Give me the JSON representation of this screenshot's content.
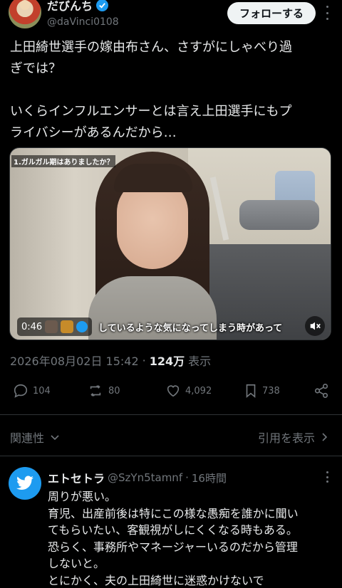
{
  "tweet": {
    "author_name": "だびんち",
    "author_handle": "@daVinci0108",
    "follow_label": "フォローする",
    "text_paragraphs": [
      [
        "上田綺世選手の嫁由布さん、さすがにしゃべり過",
        "ぎでは？"
      ],
      [
        "いくらインフルエンサーとは言え上田選手にもプ",
        "ライバシーがあるんだから…"
      ]
    ],
    "video": {
      "top_caption": "1.ガルガル期はありましたか？",
      "time": "0:46",
      "subtitle": "しているような気になってしまう時があって"
    },
    "datetime": "2026年08月02日 15:42",
    "views_count": "124万",
    "views_label": "表示",
    "actions": {
      "replies": "104",
      "retweets": "80",
      "likes": "4,092",
      "bookmarks": "738"
    }
  },
  "replies_header": {
    "sort_label": "関連性",
    "quotes_label": "引用を表示"
  },
  "reply": {
    "name": "エトセトラ",
    "handle": "@SzYn5tamnf",
    "time": "16時間",
    "lines": [
      "周りが悪い。",
      "育児、出産前後は特にこの様な愚痴を誰かに聞い",
      "てもらいたい、客観視がしにくくなる時もある。",
      "恐らく、事務所やマネージャーいるのだから管理",
      "しないと。",
      "とにかく、夫の上田綺世に迷惑かけないで"
    ]
  },
  "colors": {
    "background": "#000000",
    "text": "#e7e9ea",
    "muted": "#71767b",
    "accent": "#1d9bf0",
    "divider": "#2f3336"
  },
  "icons": [
    "verified-badge-icon",
    "more-icon",
    "reply-icon",
    "retweet-icon",
    "like-icon",
    "bookmark-icon",
    "share-icon",
    "chevron-down-icon",
    "chevron-right-icon",
    "mute-icon",
    "twitter-bird-icon"
  ]
}
